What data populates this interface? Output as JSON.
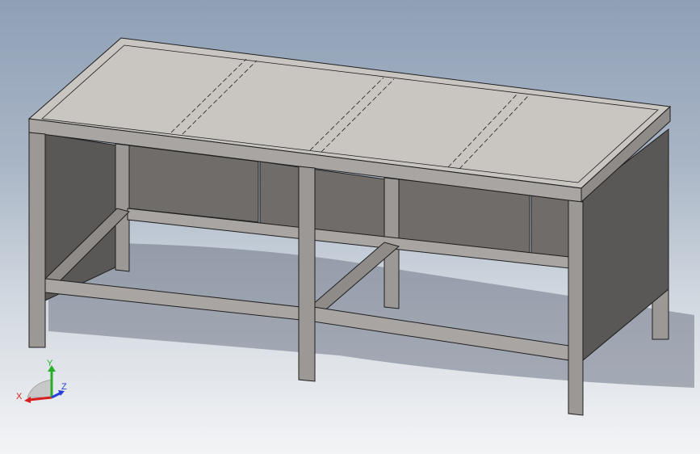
{
  "triad": {
    "x_label": "X",
    "y_label": "Y",
    "z_label": "Z",
    "x_color": "#d81e1e",
    "y_color": "#27b027",
    "z_color": "#2a3fd8"
  },
  "colors": {
    "top": "#c9c6c2",
    "top_edge": "#b8b5b1",
    "frame_front": "#a8a5a2",
    "frame_side": "#8e8b88",
    "panel_back": "#6f6c69",
    "panel_dark": "#5a5856",
    "leg_front": "#9b9895",
    "leg_side": "#7a7774",
    "edge": "#1e1e1e",
    "shadow": "#6b7380"
  }
}
